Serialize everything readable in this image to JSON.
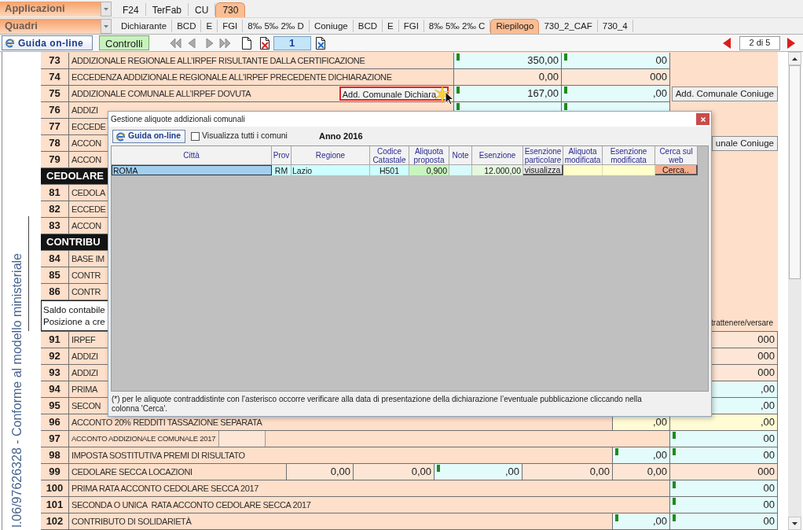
{
  "app_bar": {
    "dropdown": "Applicazioni",
    "tabs": [
      {
        "label": "F24",
        "selected": false
      },
      {
        "label": "TerFab",
        "selected": false
      },
      {
        "label": "CU",
        "selected": false
      },
      {
        "label": "730",
        "selected": true
      }
    ]
  },
  "section_bar": {
    "dropdown": "Quadri",
    "tabs": [
      {
        "label": "Dichiarante",
        "selected": false
      },
      {
        "label": "BCD",
        "selected": false
      },
      {
        "label": "E",
        "selected": false
      },
      {
        "label": "FGI",
        "selected": false
      },
      {
        "label": "8‰ 5‰ 2‰ D",
        "selected": false
      },
      {
        "label": "Coniuge",
        "selected": false
      },
      {
        "label": "BCD",
        "selected": false
      },
      {
        "label": "E",
        "selected": false
      },
      {
        "label": "FGI",
        "selected": false
      },
      {
        "label": "8‰ 5‰ 2‰ C",
        "selected": false
      },
      {
        "label": "Riepilogo",
        "selected": true
      },
      {
        "label": "730_2_CAF",
        "selected": false
      },
      {
        "label": "730_4",
        "selected": false
      }
    ]
  },
  "toolbar": {
    "help_button": "Guida on-line",
    "check_button": "Controlli",
    "record_field": "1",
    "page_field": "2 di 5"
  },
  "side_caption": "l.06/97626328 - Conforme al modello ministeriale",
  "form": {
    "rows": [
      {
        "kind": "line",
        "number": "73",
        "label": "ADDIZIONALE REGIONALE ALL’IRPEF RISULTANTE DALLA CERTIFICAZIONE",
        "cells": [
          {
            "kind": "input",
            "value": "350,00",
            "marked": true
          },
          {
            "kind": "input",
            "value": "00",
            "marked": true
          }
        ]
      },
      {
        "kind": "line",
        "number": "74",
        "label": "ECCEDENZA ADDIZIONALE REGIONALE ALL’IRPEF PRECEDENTE DICHIARAZIONE",
        "cells": [
          {
            "kind": "calc",
            "value": "0,00",
            "marked": false
          },
          {
            "kind": "calc",
            "value": "000",
            "marked": false
          }
        ]
      },
      {
        "kind": "line",
        "number": "75",
        "label": "ADDIZIONALE COMUNALE ALL’IRPEF DOVUTA",
        "action_button": {
          "label": "Add. Comunale Dichiara",
          "highlighted": true
        },
        "cells": [
          {
            "kind": "input",
            "value": "167,00",
            "marked": true
          },
          {
            "kind": "input",
            "value": ",00",
            "marked": true
          }
        ],
        "side_button": "Add. Comunale Coniuge"
      },
      {
        "kind": "line",
        "number": "76",
        "label": "ADDIZI",
        "cells": [
          {
            "kind": "input",
            "marked": true
          },
          {
            "kind": "input",
            "marked": true
          }
        ]
      },
      {
        "kind": "line",
        "number": "77",
        "label": "ECCEDE"
      },
      {
        "kind": "line",
        "number": "78",
        "label": "ACCON",
        "side_button": "unale Coniuge"
      },
      {
        "kind": "line",
        "number": "79",
        "label": "ACCON"
      },
      {
        "kind": "header",
        "label": "CEDOLARE"
      },
      {
        "kind": "line",
        "number": "81",
        "label": "CEDOLA"
      },
      {
        "kind": "line",
        "number": "82",
        "label": "ECCEDE"
      },
      {
        "kind": "line",
        "number": "83",
        "label": "ACCON"
      },
      {
        "kind": "header",
        "label": "CONTRIBU"
      },
      {
        "kind": "line",
        "number": "84",
        "label": "BASE IM"
      },
      {
        "kind": "line",
        "number": "85",
        "label": "CONTR"
      },
      {
        "kind": "line",
        "number": "86",
        "label": "CONTR"
      },
      {
        "kind": "balance",
        "lines": [
          "Saldo contabile",
          "Posizione a cre"
        ],
        "column_heading": "trattenere/versare"
      },
      {
        "kind": "entry",
        "number": "91",
        "label": "IRPEF",
        "cells": [
          {
            "kind": "calc",
            "value": "000"
          }
        ]
      },
      {
        "kind": "entry",
        "number": "92",
        "label": "ADDIZI",
        "cells": [
          {
            "kind": "calc",
            "value": "000"
          }
        ]
      },
      {
        "kind": "entry",
        "number": "93",
        "label": "ADDIZI",
        "cells": [
          {
            "kind": "calc",
            "value": "000"
          }
        ]
      },
      {
        "kind": "entry",
        "number": "94",
        "label": "PRIMA",
        "cells": [
          {
            "kind": "input",
            "value": ",00"
          }
        ]
      },
      {
        "kind": "entry",
        "number": "95",
        "label": "SECON",
        "cells": [
          {
            "kind": "input",
            "value": ",00"
          }
        ]
      },
      {
        "kind": "entry",
        "number": "96",
        "label": "ACCONTO 20% REDDITI TASSAZIONE SEPARATA",
        "cells": [
          {
            "kind": "total",
            "value": ",00",
            "marked": false
          },
          {
            "kind": "total",
            "value": ",00",
            "marked": false
          }
        ]
      },
      {
        "kind": "entry_field",
        "number": "97",
        "label": "ACCONTO ADDIZIONALE COMUNALE 2017",
        "cells": [
          {
            "kind": "input",
            "value": "00",
            "marked": true
          }
        ]
      },
      {
        "kind": "entry",
        "number": "98",
        "label": "IMPOSTA SOSTITUTIVA PREMI DI RISULTATO",
        "cells": [
          {
            "kind": "input",
            "value": ",00",
            "marked": true
          },
          {
            "kind": "input",
            "value": "00",
            "marked": true
          }
        ]
      },
      {
        "kind": "entry",
        "number": "99",
        "label": "CEDOLARE SECCA LOCAZIONI",
        "cells": [
          {
            "kind": "calc",
            "value": "0,00",
            "marked": false
          },
          {
            "kind": "calc",
            "value": "0,00",
            "marked": false
          },
          {
            "kind": "input",
            "value": ",00",
            "marked": true
          },
          {
            "kind": "calc",
            "value": "0,00",
            "marked": false
          },
          {
            "kind": "calc",
            "value": "0,00",
            "marked": false
          },
          {
            "kind": "calc",
            "value": "000",
            "marked": false
          }
        ]
      },
      {
        "kind": "entry",
        "number": "100",
        "label": "PRIMA RATA ACCONTO CEDOLARE SECCA 2017",
        "cells": [
          {
            "kind": "input",
            "value": "00",
            "marked": true
          }
        ]
      },
      {
        "kind": "entry",
        "number": "101",
        "label": "SECONDA O UNICA  RATA ACCONTO CEDOLARE SECCA 2017",
        "cells": [
          {
            "kind": "input",
            "value": "00",
            "marked": true
          }
        ]
      },
      {
        "kind": "entry",
        "number": "102",
        "label": "CONTRIBUTO DI SOLIDARIETÀ",
        "cells": [
          {
            "kind": "input",
            "value": ",00",
            "marked": true
          },
          {
            "kind": "input",
            "value": "00",
            "marked": true
          }
        ]
      }
    ]
  },
  "dialog": {
    "title": "Gestione aliquote addizionali comunali",
    "help_button": "Guida on-line",
    "show_all": {
      "label": "Visualizza tutti i comuni",
      "checked": false
    },
    "year": "Anno 2016",
    "table": {
      "columns": [
        "Città",
        "Prov",
        "Regione",
        "Codice Catastale",
        "Aliquota proposta",
        "Note",
        "Esenzione",
        "Esenzione particolare",
        "Aliquota modificata",
        "Esenzione modificata",
        "Cerca sul web"
      ],
      "rows": [
        {
          "selected": true,
          "cells": [
            {
              "kind": "text",
              "value": "ROMA"
            },
            {
              "kind": "code",
              "value": "RM"
            },
            {
              "kind": "text",
              "value": "Lazio"
            },
            {
              "kind": "code",
              "value": "H501"
            },
            {
              "kind": "rate",
              "value": "0,900"
            },
            {
              "kind": "note"
            },
            {
              "kind": "amount",
              "value": "12.000,00"
            },
            {
              "kind": "button",
              "value": "visualizza"
            },
            {
              "kind": "edit"
            },
            {
              "kind": "edit"
            },
            {
              "kind": "web_button",
              "value": "Cerca.."
            }
          ]
        }
      ]
    },
    "footnote": "(*) per le aliquote contraddistinte con l’asterisco occorre verificare alla data di presentazione della dichiarazione l’eventuale pubblicazione cliccando nella colonna 'Cerca'."
  }
}
